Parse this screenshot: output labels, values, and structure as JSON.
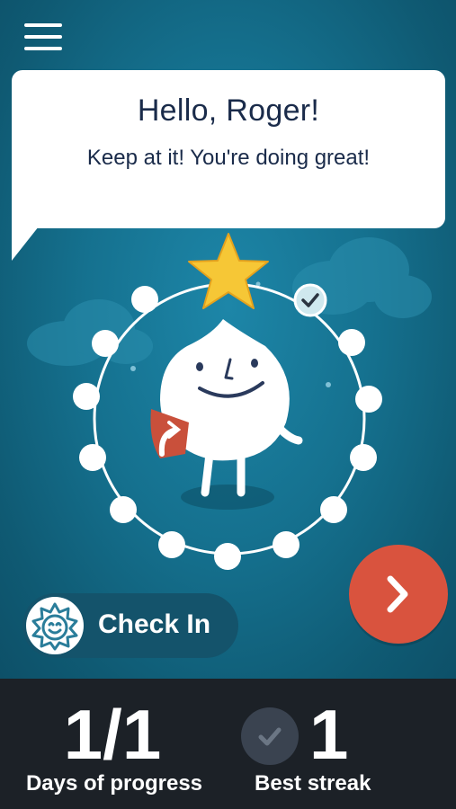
{
  "bubble": {
    "greeting": "Hello, Roger!",
    "message": "Keep at it! You're doing great!"
  },
  "checkin": {
    "label": "Check In"
  },
  "stats": {
    "days_value": "1/1",
    "days_label": "Days of progress",
    "streak_value": "1",
    "streak_label": "Best streak"
  },
  "colors": {
    "background": "#15718f",
    "bubble_text": "#1a2b4a",
    "star": "#f6c736",
    "next_button": "#d9533e",
    "stats_bar": "#1c2127"
  },
  "icons": [
    "menu-icon",
    "sun-icon",
    "chevron-right-icon",
    "checkmark-icon",
    "star-icon"
  ]
}
